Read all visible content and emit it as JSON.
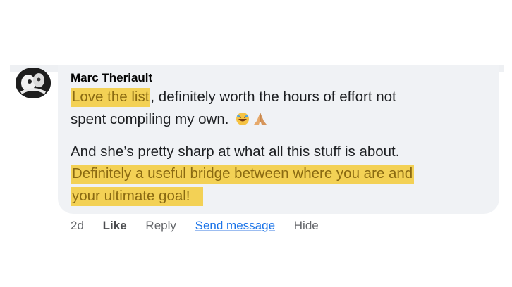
{
  "comment": {
    "author": "Marc Theriault",
    "line1_highlight": "Love the list",
    "line1_rest": ", definitely worth the hours of effort not",
    "line2": "spent compiling my own.",
    "line3": "And she’s pretty sharp at what all this stuff is about.",
    "line4_highlight": "Definitely a useful bridge between where you are and",
    "line5_highlight": "your ultimate goal!",
    "emojis": [
      "rolling-on-floor-laughing-emoji",
      "folded-hands-emoji"
    ]
  },
  "actions": {
    "time": "2d",
    "like": "Like",
    "reply": "Reply",
    "send_message": "Send message",
    "hide": "Hide"
  },
  "colors": {
    "highlight": "#f3d155",
    "bubble": "#f0f2f5",
    "link": "#1a73e8"
  }
}
